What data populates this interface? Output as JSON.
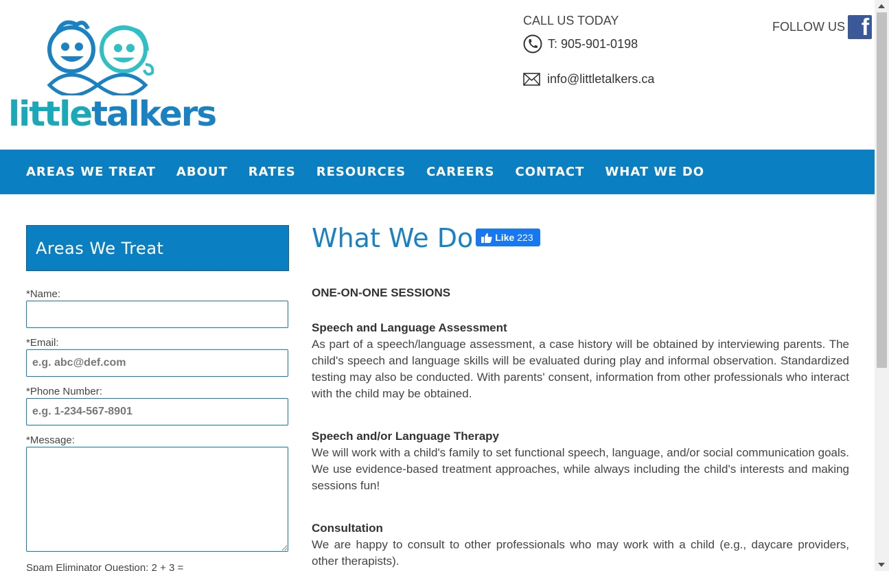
{
  "header": {
    "logo_text_1": "little",
    "logo_text_2": "talkers",
    "call_label": "CALL US TODAY",
    "phone": "T: 905-901-0198",
    "email": "info@littletalkers.ca",
    "follow_label": "FOLLOW US"
  },
  "nav": {
    "items": [
      "AREAS WE TREAT",
      "ABOUT",
      "RATES",
      "RESOURCES",
      "CAREERS",
      "CONTACT",
      "WHAT WE DO"
    ]
  },
  "sidebar": {
    "title": "Areas We Treat",
    "name_label": "*Name:",
    "name_value": "",
    "email_label": "*Email:",
    "email_placeholder": "e.g. abc@def.com",
    "phone_label": "*Phone Number:",
    "phone_placeholder": "e.g. 1-234-567-8901",
    "message_label": "*Message:",
    "spam_label": "Spam Eliminator Question: 2 + 3 ="
  },
  "main": {
    "title": "What We Do",
    "like_label": "Like",
    "like_count": "223",
    "section_heading": "ONE-ON-ONE SESSIONS",
    "blocks": [
      {
        "heading": "Speech and Language Assessment",
        "body": "As part of a speech/language assessment, a case history will be obtained by interviewing parents.  The child's speech and language skills will be evaluated during play and informal observation. Standardized testing may also be conducted. With parents' consent, information from other professionals who interact with the child may be obtained."
      },
      {
        "heading": "Speech and/or Language Therapy",
        "body": "We will work with a child's family to set functional speech, language, and/or social communication goals.  We use evidence-based treatment approaches, while always including the child's interests and making sessions fun!"
      },
      {
        "heading": "Consultation",
        "body": "We are happy to consult to other professionals who may work with a child (e.g., daycare providers, other therapists)."
      }
    ]
  },
  "colors": {
    "brand_blue": "#0a80c2",
    "title_blue": "#1a82c2",
    "logo_teal": "#1aa9b8",
    "facebook": "#3b5998",
    "like_button": "#1877f2"
  },
  "icons": [
    "phone-icon",
    "mail-icon",
    "facebook-icon",
    "thumbs-up-icon"
  ]
}
